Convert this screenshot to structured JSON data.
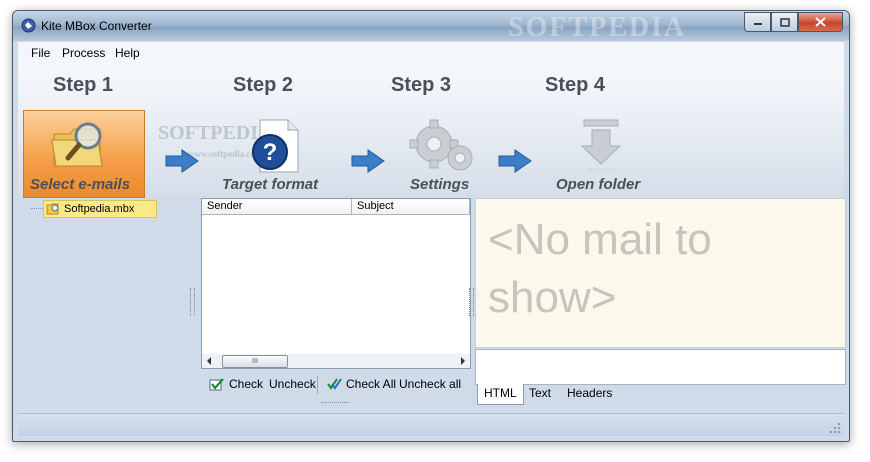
{
  "window": {
    "title": "Kite MBox Converter",
    "title_watermark": "SOFTPEDIA"
  },
  "menu": [
    "File",
    "Process",
    "Help"
  ],
  "steps": [
    {
      "title": "Step 1",
      "caption": "Select e-mails",
      "icon": "magnifier-folder-icon",
      "active": true
    },
    {
      "title": "Step 2",
      "caption": "Target format",
      "icon": "question-document-icon",
      "active": false
    },
    {
      "title": "Step 3",
      "caption": "Settings",
      "icon": "gears-icon",
      "active": false
    },
    {
      "title": "Step 4",
      "caption": "Open folder",
      "icon": "down-arrow-icon",
      "active": false
    }
  ],
  "step_watermark": {
    "brand": "SOFTPEDIA",
    "url": "www.softpedia.com"
  },
  "tree": {
    "items": [
      {
        "label": "Softpedia.mbx",
        "selected": true,
        "icon": "mbox-file-icon"
      }
    ]
  },
  "mail_list": {
    "columns": [
      "Sender",
      "Subject"
    ],
    "rows": [],
    "scroll_thumb": "III"
  },
  "check_bar": {
    "check": "Check",
    "uncheck": "Uncheck",
    "check_all": "Check All",
    "uncheck_all": "Uncheck all"
  },
  "preview": {
    "empty_text": "<No mail to show>",
    "tabs": [
      "HTML",
      "Text",
      "Headers"
    ],
    "active_tab": "HTML"
  },
  "colors": {
    "accent_orange": "#f5a04a",
    "arrow_blue": "#3a7fc8",
    "selection_yellow": "#fbe98a",
    "preview_bg": "#fdf8ec"
  }
}
